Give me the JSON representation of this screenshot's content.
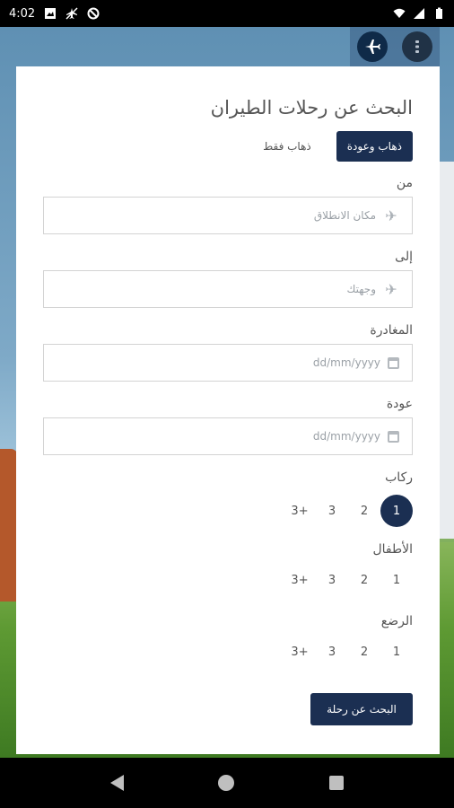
{
  "status_bar": {
    "time": "4:02"
  },
  "header_nav": {
    "flight_icon": "airplane-icon",
    "menu_icon": "menu-icon"
  },
  "card": {
    "title": "البحث عن رحلات الطيران",
    "trip_type": {
      "round_trip": "ذهاب وعودة",
      "one_way": "ذهاب فقط"
    },
    "from": {
      "label": "من",
      "placeholder": "مكان الانطلاق"
    },
    "to": {
      "label": "إلى",
      "placeholder": "وجهتك"
    },
    "departure": {
      "label": "المغادرة",
      "placeholder": "dd/mm/yyyy"
    },
    "return": {
      "label": "عودة",
      "placeholder": "dd/mm/yyyy"
    },
    "passengers": {
      "label": "ركاب",
      "options": [
        "1",
        "2",
        "3",
        "+3"
      ],
      "selected": "1"
    },
    "children": {
      "label": "الأطفال",
      "options": [
        "1",
        "2",
        "3",
        "+3"
      ]
    },
    "infants": {
      "label": "الرضع",
      "options": [
        "1",
        "2",
        "3",
        "+3"
      ]
    },
    "search_button": "البحث عن رحلة"
  },
  "colors": {
    "primary": "#1b2f52",
    "background": "#ffffff"
  }
}
